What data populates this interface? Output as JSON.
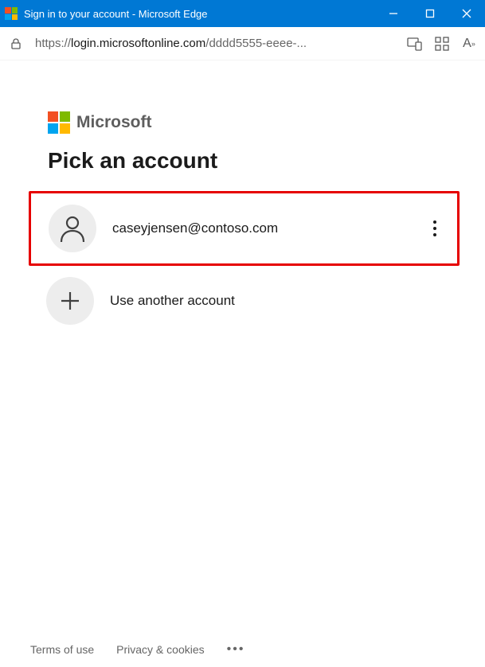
{
  "window": {
    "title": "Sign in to your account - Microsoft Edge"
  },
  "address": {
    "scheme": "https://",
    "host": "login.microsoftonline.com",
    "path": "/dddd5555-eeee-..."
  },
  "brand": {
    "name": "Microsoft"
  },
  "heading": "Pick an account",
  "accounts": [
    {
      "label": "caseyjensen@contoso.com"
    }
  ],
  "useAnother": "Use another account",
  "footer": {
    "terms": "Terms of use",
    "privacy": "Privacy & cookies"
  }
}
